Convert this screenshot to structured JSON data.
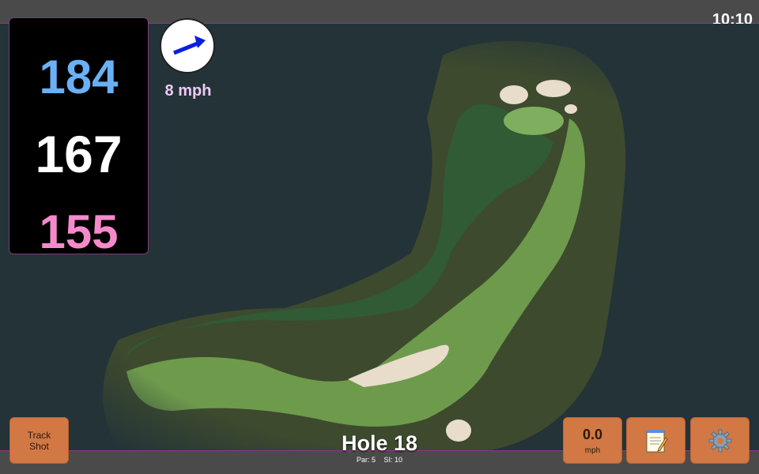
{
  "status": {
    "clock": "10:10"
  },
  "distances": {
    "back": "184",
    "middle": "167",
    "front": "155"
  },
  "wind": {
    "speed_label": "8 mph",
    "button_value": "0.0",
    "button_unit": "mph"
  },
  "buttons": {
    "track_shot": "Track\nShot"
  },
  "hole": {
    "title": "Hole 18",
    "par": "Par: 5",
    "si": "SI: 10"
  },
  "icons": {
    "wind": "wind-direction-arrow-icon",
    "notes": "notepad-icon",
    "settings": "gear-icon"
  },
  "colors": {
    "back": "#6ab0f5",
    "middle": "#ffffff",
    "front": "#f58acb",
    "button": "#d27844"
  }
}
